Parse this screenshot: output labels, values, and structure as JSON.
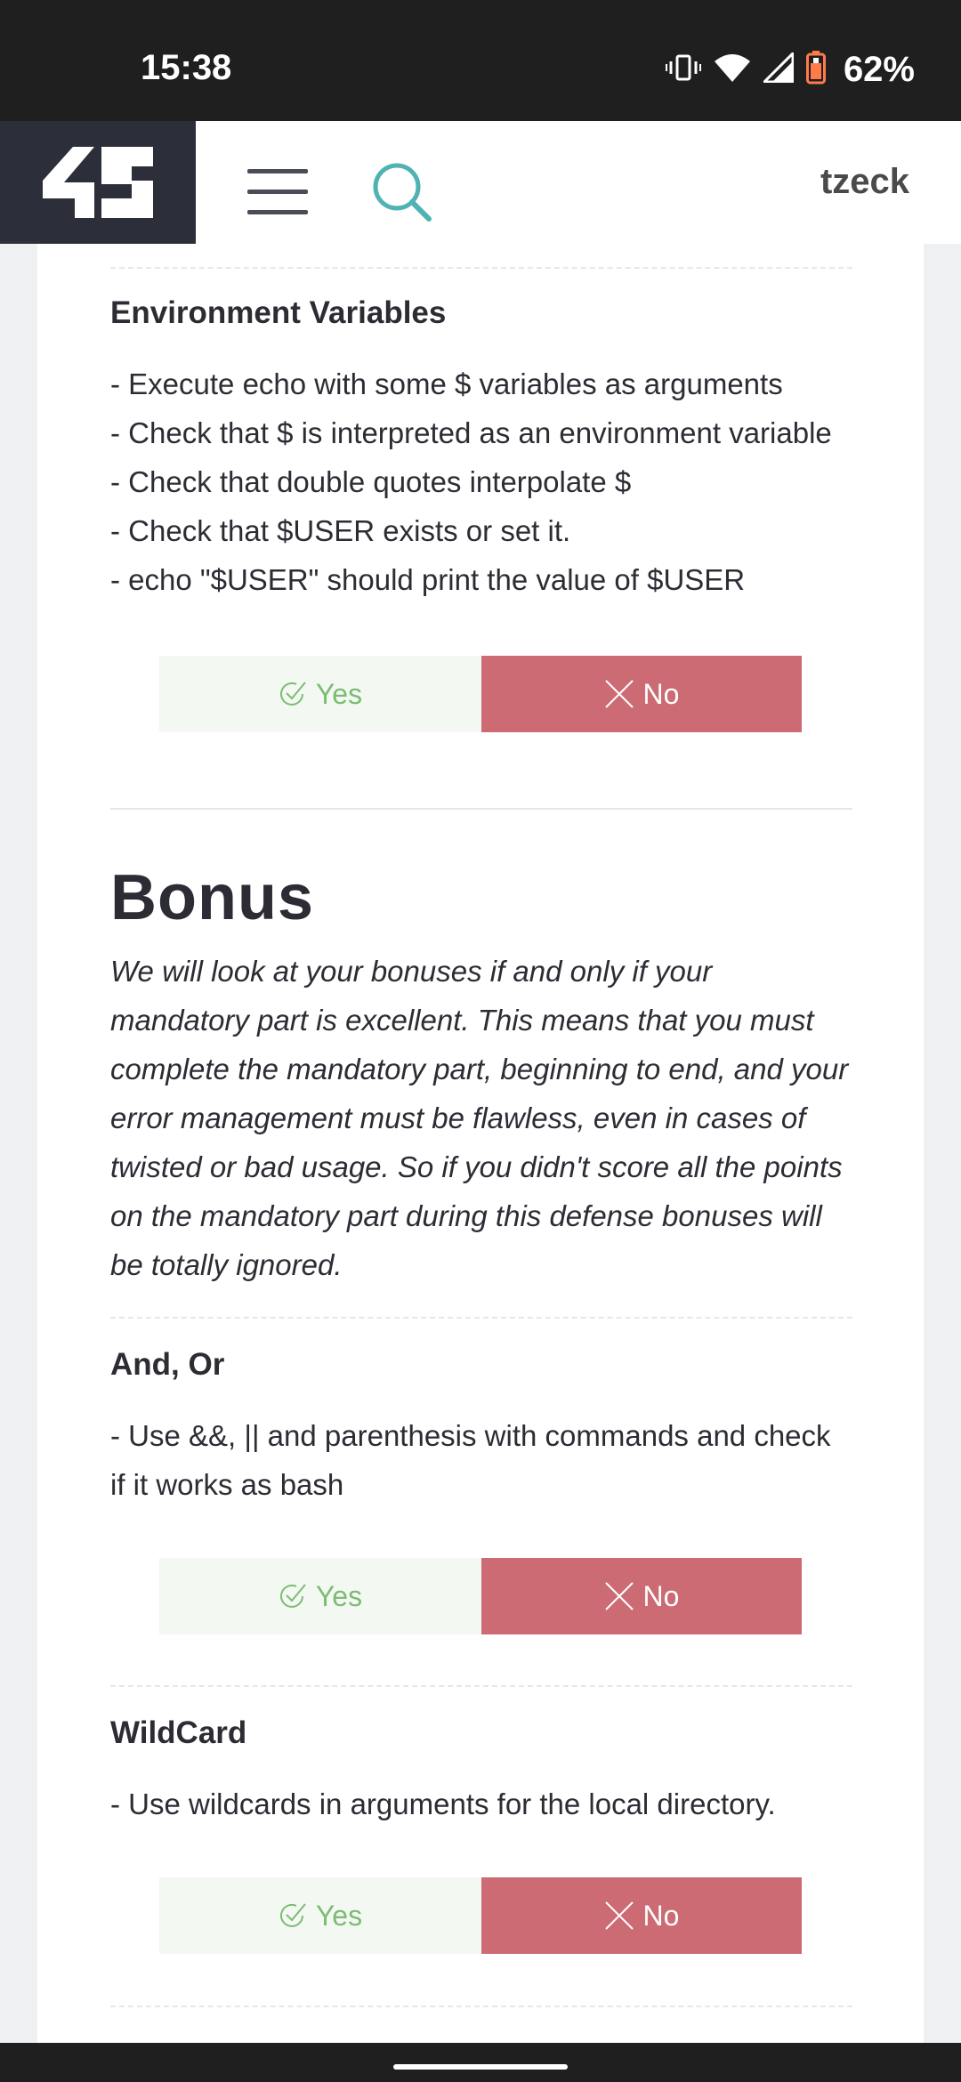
{
  "status_bar": {
    "time": "15:38",
    "battery_pct": "62%",
    "icons": [
      "vibrate-icon",
      "wifi-icon",
      "signal-icon",
      "battery-icon"
    ]
  },
  "header": {
    "logo": "42",
    "username": "tzeck",
    "icons": [
      "menu-icon",
      "search-icon"
    ]
  },
  "sections": [
    {
      "title": "Environment Variables",
      "lines": [
        "- Execute echo with some $ variables as arguments",
        "- Check that $ is interpreted as an environment variable",
        "- Check that double quotes interpolate $",
        "- Check that $USER exists or set it.",
        "- echo \"$USER\" should print the value of $USER"
      ],
      "yes": "Yes",
      "no": "No"
    }
  ],
  "bonus": {
    "title": "Bonus",
    "intro": "We will look at your bonuses if and only if your mandatory part is excellent. This means that you must complete the mandatory part, beginning to end, and your error management must be flawless, even in cases of twisted or bad usage. So if you didn't score all the points on the mandatory part during this defense bonuses will be totally ignored.",
    "items": [
      {
        "title": "And, Or",
        "lines": [
          "- Use &&, || and parenthesis with commands and check if it works as bash"
        ],
        "yes": "Yes",
        "no": "No"
      },
      {
        "title": "WildCard",
        "lines": [
          "- Use wildcards in arguments for the local directory."
        ],
        "yes": "Yes",
        "no": "No"
      }
    ]
  },
  "colors": {
    "yes_text": "#7cbc72",
    "yes_bg": "#f3f8f3",
    "no_bg": "#cc6b73",
    "search_icon": "#4fb3b3",
    "logo_bg": "#2c2f3a"
  }
}
